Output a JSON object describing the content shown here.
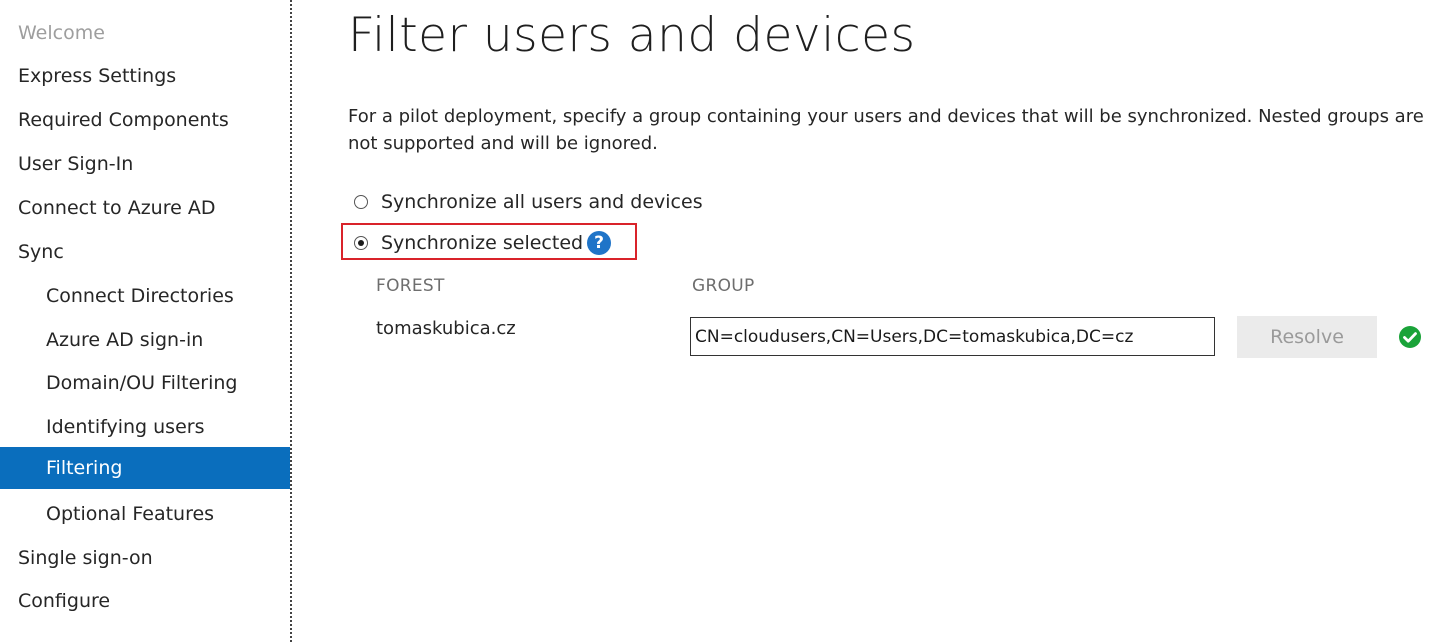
{
  "sidebar": {
    "items": [
      {
        "label": "Welcome"
      },
      {
        "label": "Express Settings"
      },
      {
        "label": "Required Components"
      },
      {
        "label": "User Sign-In"
      },
      {
        "label": "Connect to Azure AD"
      },
      {
        "label": "Sync"
      },
      {
        "label": "Connect Directories"
      },
      {
        "label": "Azure AD sign-in"
      },
      {
        "label": "Domain/OU Filtering"
      },
      {
        "label": "Identifying users"
      },
      {
        "label": "Filtering"
      },
      {
        "label": "Optional Features"
      },
      {
        "label": "Single sign-on"
      },
      {
        "label": "Configure"
      }
    ],
    "active_item": "Filtering",
    "active_color": "#0a6ebd"
  },
  "main": {
    "title": "Filter users and devices",
    "description": "For a pilot deployment, specify a group containing your users and devices that will be synchronized. Nested groups are not supported and will be ignored.",
    "options": [
      {
        "label": "Synchronize all users and devices",
        "selected": false
      },
      {
        "label": "Synchronize selected",
        "selected": true
      }
    ],
    "help_icon": "question-circle-icon",
    "table": {
      "headers": [
        "FOREST",
        "GROUP"
      ],
      "forest": "tomaskubica.cz",
      "group_value": "CN=cloudusers,CN=Users,DC=tomaskubica,DC=cz",
      "resolve_label": "Resolve",
      "status_icon": "check-circle-icon",
      "status_color": "#1aa339"
    },
    "highlight_color": "#d9232a"
  }
}
